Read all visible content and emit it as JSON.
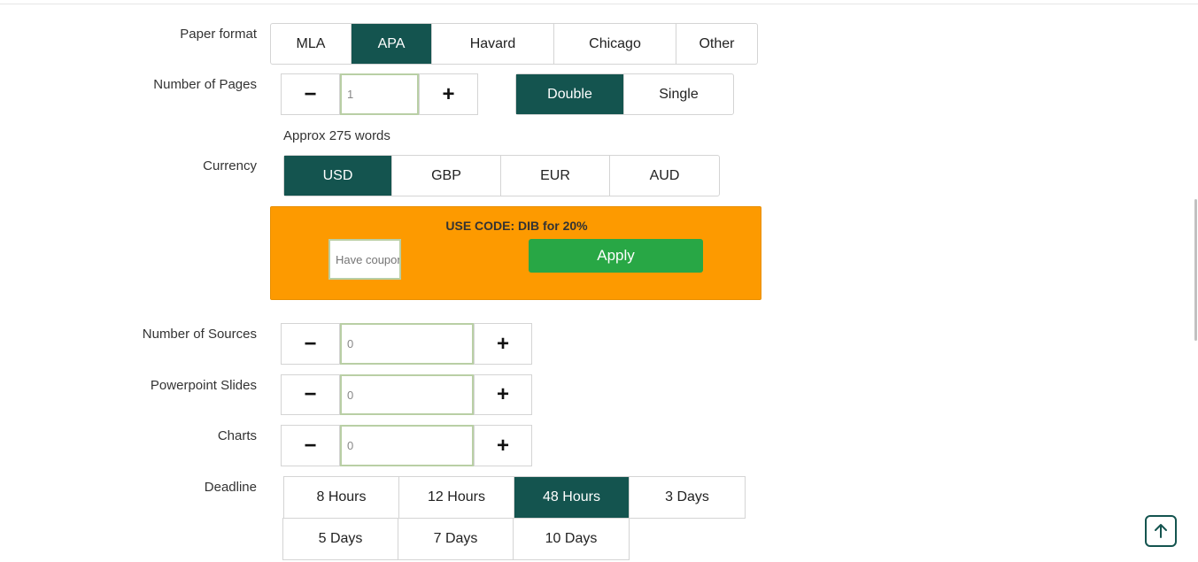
{
  "paper_format": {
    "label": "Paper format",
    "options": [
      "MLA",
      "APA",
      "Havard",
      "Chicago",
      "Other"
    ],
    "selected": "APA"
  },
  "pages": {
    "label": "Number of Pages",
    "value": "1",
    "minus": "−",
    "plus": "+",
    "spacing_options": [
      "Double",
      "Single"
    ],
    "spacing_selected": "Double",
    "approx": "Approx 275 words"
  },
  "currency": {
    "label": "Currency",
    "options": [
      "USD",
      "GBP",
      "EUR",
      "AUD"
    ],
    "selected": "USD"
  },
  "coupon": {
    "code_text": "USE CODE: DIB for 20%",
    "placeholder": "Have coupon?",
    "apply_label": "Apply",
    "bg_color": "#fd9a00",
    "button_color": "#28a745"
  },
  "sources": {
    "label": "Number of Sources",
    "value": "0",
    "minus": "−",
    "plus": "+"
  },
  "slides": {
    "label": "Powerpoint Slides",
    "value": "0",
    "minus": "−",
    "plus": "+"
  },
  "charts": {
    "label": "Charts",
    "value": "0",
    "minus": "−",
    "plus": "+"
  },
  "deadline": {
    "label": "Deadline",
    "row1": [
      "8 Hours",
      "12 Hours",
      "48 Hours",
      "3 Days"
    ],
    "row2": [
      "5 Days",
      "7 Days",
      "10 Days"
    ],
    "selected": "48 Hours"
  },
  "theme": {
    "accent": "#14544f"
  },
  "scroll_top_icon": "arrow-up-icon"
}
